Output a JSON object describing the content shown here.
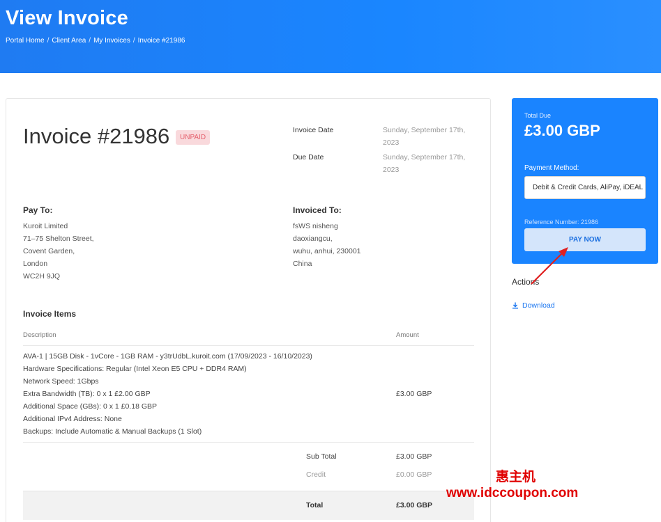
{
  "header": {
    "title": "View Invoice",
    "breadcrumbs": [
      "Portal Home",
      "Client Area",
      "My Invoices",
      "Invoice #21986"
    ]
  },
  "invoice": {
    "title": "Invoice #21986",
    "status": "UNPAID",
    "invoice_date_label": "Invoice Date",
    "invoice_date": "Sunday, September 17th, 2023",
    "due_date_label": "Due Date",
    "due_date": "Sunday, September 17th, 2023",
    "pay_to": {
      "heading": "Pay To:",
      "lines": [
        "Kuroit Limited",
        "71–75 Shelton Street,",
        "Covent Garden,",
        "London",
        "WC2H 9JQ"
      ]
    },
    "invoiced_to": {
      "heading": "Invoiced To:",
      "lines": [
        "fsWS nisheng",
        "daoxiangcu,",
        "wuhu, anhui, 230001",
        "China"
      ]
    },
    "items": {
      "heading": "Invoice Items",
      "col_description": "Description",
      "col_amount": "Amount",
      "rows": [
        {
          "lines": [
            "AVA-1 | 15GB Disk - 1vCore - 1GB RAM - y3trUdbL.kuroit.com (17/09/2023 - 16/10/2023)",
            "Hardware Specifications: Regular (Intel Xeon E5 CPU + DDR4 RAM)",
            "Network Speed: 1Gbps",
            "Extra Bandwidth (TB): 0 x 1 £2.00 GBP",
            "Additional Space (GBs): 0 x 1 £0.18 GBP",
            "Additional IPv4 Address: None",
            "Backups: Include Automatic & Manual Backups (1 Slot)"
          ],
          "amount": "£3.00 GBP"
        }
      ]
    },
    "totals": {
      "sub_total_label": "Sub Total",
      "sub_total": "£3.00 GBP",
      "credit_label": "Credit",
      "credit": "£0.00 GBP",
      "total_label": "Total",
      "total": "£3.00 GBP"
    }
  },
  "sidebar": {
    "total_due_label": "Total Due",
    "total_due": "£3.00 GBP",
    "payment_method_label": "Payment Method:",
    "payment_method_value": "Debit & Credit Cards, AliPay, iDEAL",
    "reference": "Reference Number: 21986",
    "pay_now": "PAY NOW",
    "accent": "#1a84ff"
  },
  "actions": {
    "heading": "Actions",
    "download": "Download",
    "download_icon": "download-icon"
  },
  "watermark": {
    "line1": "惠主机",
    "line2": "www.idccoupon.com",
    "color": "#e00000"
  }
}
